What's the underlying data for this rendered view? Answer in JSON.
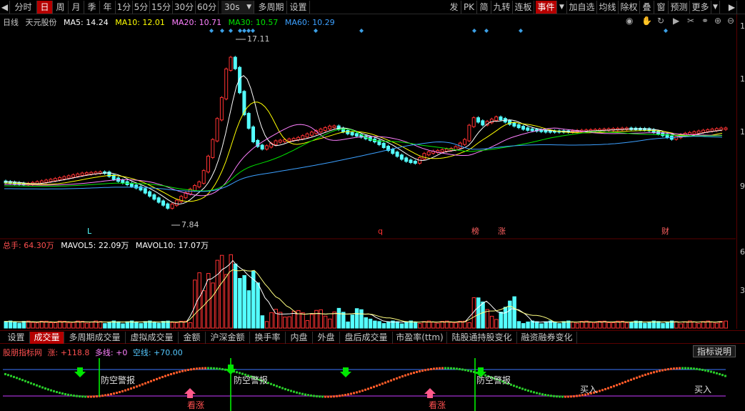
{
  "toolbar": {
    "left_items": [
      "分时",
      "日",
      "周",
      "月",
      "季",
      "年",
      "1分",
      "5分",
      "15分",
      "30分",
      "60分",
      "30s",
      "多周期",
      "设置"
    ],
    "active_item": "日",
    "right_items": [
      "发",
      "PK",
      "简",
      "九转",
      "连板",
      "事件",
      "加自选",
      "均线",
      "除权",
      "叠",
      "窗",
      "预测",
      "更多"
    ]
  },
  "main_chart": {
    "period_label": "日线",
    "stock_name": "天元股份",
    "ma5_label": "MA5: 14.24",
    "ma10_label": "MA10: 12.01",
    "ma20_label": "MA20: 10.71",
    "ma30_label": "MA30: 10.57",
    "ma60_label": "MA60: 10.29",
    "high_marker": "17.11",
    "low_marker": "7.84",
    "y_ticks": [
      "1",
      "1",
      "1",
      "9"
    ],
    "event_markers": [
      "L",
      "q",
      "榜",
      "涨",
      "财"
    ],
    "colors": {
      "up": "#ff3232",
      "down": "#54ffff",
      "ma5": "#ffffff",
      "ma10": "#ffff00",
      "ma20": "#ff80ff",
      "ma30": "#00e600",
      "ma60": "#3ca0ff"
    }
  },
  "volume_chart": {
    "total_label": "总手: 64.30万",
    "mavol5_label": "MAVOL5: 22.09万",
    "mavol10_label": "MAVOL10: 17.07万",
    "y_ticks": [
      "6",
      "3"
    ]
  },
  "tabs": [
    "设置",
    "成交量",
    "多周期成交量",
    "虚拟成交量",
    "金额",
    "沪深金额",
    "换手率",
    "内盘",
    "外盘",
    "盘后成交量",
    "市盈率(ttm)",
    "陆股通持股变化",
    "融资融券变化"
  ],
  "active_tab": "成交量",
  "indicator": {
    "name": "股朋指标网",
    "rise_label": "涨: +118.8",
    "long_label": "多线: +0",
    "short_label": "空线: +70.00",
    "explain_button": "指标说明",
    "signals": [
      "防空警报",
      "防空警报",
      "防空警报",
      "看涨",
      "看涨",
      "买入",
      "买入"
    ]
  }
}
